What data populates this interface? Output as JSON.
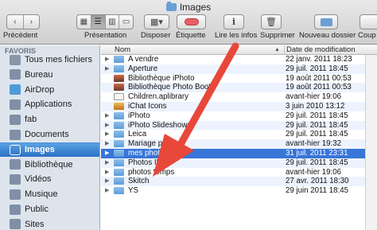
{
  "window": {
    "title": "Images"
  },
  "toolbar": {
    "back_forward": {
      "back_icon": "‹",
      "forward_icon": "›",
      "label": "Précédent"
    },
    "presentation": {
      "label": "Présentation"
    },
    "disposer": {
      "label": "Disposer"
    },
    "etiquette": {
      "label": "Étiquette"
    },
    "infos": {
      "label": "Lire les infos"
    },
    "supprimer": {
      "label": "Supprimer"
    },
    "nouveau_dossier": {
      "label": "Nouveau dossier"
    },
    "coup": {
      "label": "Coup"
    }
  },
  "sidebar": {
    "heading": "FAVORIS",
    "items": [
      {
        "label": "Tous mes fichiers",
        "icon": "all-files-icon",
        "color": "#8a96a8"
      },
      {
        "label": "Bureau",
        "icon": "desktop-icon",
        "color": "#7f8fa6"
      },
      {
        "label": "AirDrop",
        "icon": "airdrop-icon",
        "color": "#4d9bd8"
      },
      {
        "label": "Applications",
        "icon": "applications-icon",
        "color": "#7f8fa6"
      },
      {
        "label": "fab",
        "icon": "home-icon",
        "color": "#7f8fa6"
      },
      {
        "label": "Documents",
        "icon": "documents-icon",
        "color": "#7f8fa6"
      },
      {
        "label": "Images",
        "icon": "camera-icon",
        "color": "#ffffff",
        "selected": true
      },
      {
        "label": "Bibliothèque",
        "icon": "library-icon",
        "color": "#7f8fa6"
      },
      {
        "label": "Vidéos",
        "icon": "movies-icon",
        "color": "#7f8fa6"
      },
      {
        "label": "Musique",
        "icon": "music-icon",
        "color": "#7f8fa6"
      },
      {
        "label": "Public",
        "icon": "public-icon",
        "color": "#7f8fa6"
      },
      {
        "label": "Sites",
        "icon": "sites-icon",
        "color": "#7f8fa6"
      }
    ]
  },
  "columns": {
    "name": "Nom",
    "date": "Date de modification"
  },
  "files": [
    {
      "name": "A vendre",
      "date": "22 janv. 2011 18:23",
      "kind": "folder",
      "expandable": true
    },
    {
      "name": "Aperture",
      "date": "29 juil. 2011 18:45",
      "kind": "folder",
      "expandable": true
    },
    {
      "name": "Bibliothèque iPhoto",
      "date": "19 août 2011 00:53",
      "kind": "photo",
      "expandable": false
    },
    {
      "name": "Bibliothèque Photo Booth",
      "date": "19 août 2011 00:53",
      "kind": "photo",
      "expandable": false
    },
    {
      "name": "Children.aplibrary",
      "date": "avant-hier 19:06",
      "kind": "file",
      "expandable": false
    },
    {
      "name": "iChat Icons",
      "date": "3 juin 2010 13:12",
      "kind": "app",
      "expandable": false
    },
    {
      "name": "iPhoto",
      "date": "29 juil. 2011 18:45",
      "kind": "folder",
      "expandable": true
    },
    {
      "name": "iPhoto Slideshows",
      "date": "29 juil. 2011 18:45",
      "kind": "folder",
      "expandable": true
    },
    {
      "name": "Leica",
      "date": "29 juil. 2011 18:45",
      "kind": "folder",
      "expandable": true
    },
    {
      "name": "Mariage peggy",
      "date": "avant-hier 19:32",
      "kind": "folder",
      "expandable": true
    },
    {
      "name": "mes photo",
      "date": "31 juil. 2011 23:31",
      "kind": "folder",
      "expandable": true,
      "selected": true
    },
    {
      "name": "Photos ID",
      "date": "29 juil. 2011 18:45",
      "kind": "folder",
      "expandable": true
    },
    {
      "name": "photos temps",
      "date": "avant-hier 19:06",
      "kind": "folder",
      "expandable": true
    },
    {
      "name": "Skitch",
      "date": "27 avr. 2011 18:30",
      "kind": "folder",
      "expandable": true
    },
    {
      "name": "YS",
      "date": "29 juin 2011 18:45",
      "kind": "folder",
      "expandable": true
    }
  ],
  "colors": {
    "selection": "#3875d7",
    "sidebar_bg": "#dde4ec",
    "arrow": "#e8483a"
  }
}
